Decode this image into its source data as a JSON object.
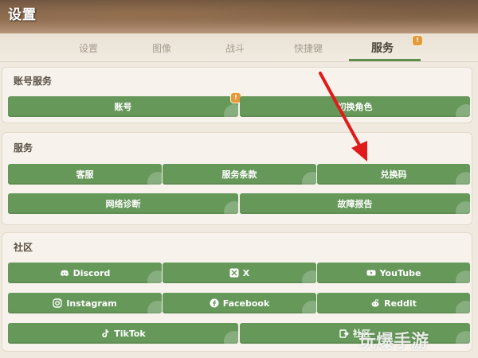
{
  "header": {
    "title": "设置"
  },
  "tabs": [
    {
      "label": "设置"
    },
    {
      "label": "图像"
    },
    {
      "label": "战斗"
    },
    {
      "label": "快捷键"
    },
    {
      "label": "服务"
    }
  ],
  "badges": {
    "tab_services": "!",
    "account": "!"
  },
  "sections": {
    "account": {
      "title": "账号服务",
      "buttons": [
        "账号",
        "切换角色"
      ]
    },
    "services": {
      "title": "服务",
      "buttons": [
        "客服",
        "服务条款",
        "兑换码",
        "网络诊断",
        "故障报告"
      ]
    },
    "community": {
      "title": "社区",
      "buttons": [
        "Discord",
        "X",
        "YouTube",
        "Instagram",
        "Facebook",
        "Reddit",
        "TikTok",
        "社区"
      ]
    }
  },
  "watermark": {
    "text": "玩爆手游"
  },
  "colors": {
    "button": "#66985a",
    "active_tab_underline": "#5e8d4f",
    "arrow": "#e01b1b",
    "badge": "#e39a3a"
  },
  "icons": {
    "discord": "discord-icon",
    "x": "x-logo-icon",
    "youtube": "youtube-icon",
    "instagram": "instagram-icon",
    "facebook": "facebook-icon",
    "reddit": "reddit-icon",
    "tiktok": "tiktok-icon",
    "community": "external-link-icon"
  }
}
